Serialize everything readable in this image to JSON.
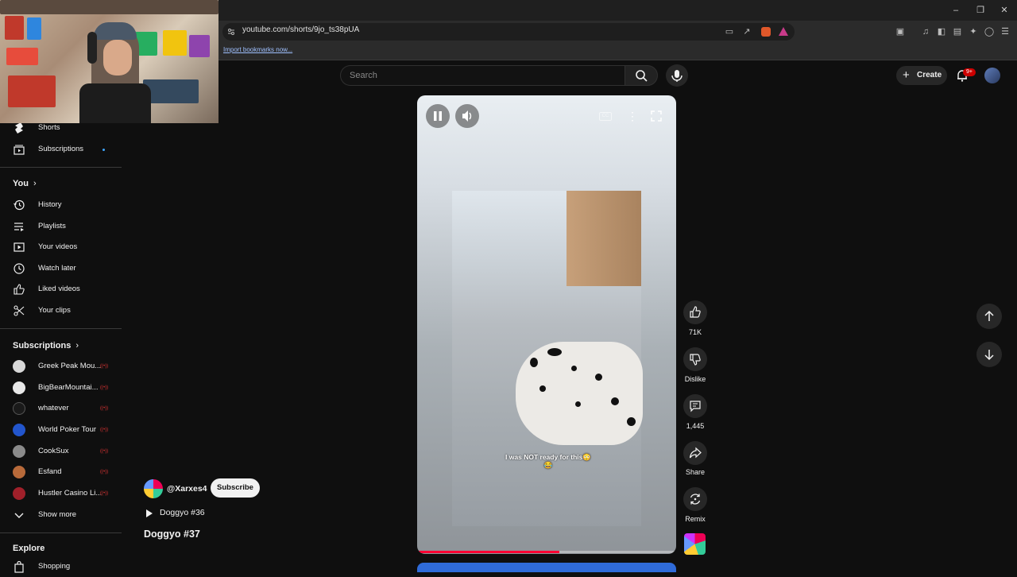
{
  "browser": {
    "url": "youtube.com/shorts/9jo_ts38pUA",
    "bookmark_text": "Import bookmarks now...",
    "window_controls": [
      "minimize-icon",
      "restore-icon",
      "close-icon"
    ]
  },
  "header": {
    "search_placeholder": "Search",
    "create_label": "Create",
    "notification_badge": "9+"
  },
  "sidebar": {
    "top_items": [
      {
        "label": "Shorts",
        "icon": "shorts-icon"
      },
      {
        "label": "Subscriptions",
        "icon": "subscriptions-icon"
      }
    ],
    "you_heading": "You",
    "you_items": [
      {
        "label": "History",
        "icon": "history-icon"
      },
      {
        "label": "Playlists",
        "icon": "playlists-icon"
      },
      {
        "label": "Your videos",
        "icon": "your-videos-icon"
      },
      {
        "label": "Watch later",
        "icon": "watch-later-icon"
      },
      {
        "label": "Liked videos",
        "icon": "liked-videos-icon"
      },
      {
        "label": "Your clips",
        "icon": "clips-icon"
      }
    ],
    "subscriptions_heading": "Subscriptions",
    "subscriptions": [
      {
        "label": "Greek Peak Mou...",
        "color": "#d8d8d8"
      },
      {
        "label": "BigBearMountai...",
        "color": "#e8e8e8"
      },
      {
        "label": "whatever",
        "color": "#1a1a1a"
      },
      {
        "label": "World Poker Tour",
        "color": "#2255cc"
      },
      {
        "label": "CookSux",
        "color": "#8a8a8a"
      },
      {
        "label": "Esfand",
        "color": "#b86a3a"
      },
      {
        "label": "Hustler Casino Li...",
        "color": "#a0202a"
      }
    ],
    "show_more": "Show more",
    "explore_heading": "Explore",
    "explore_items": [
      {
        "label": "Shopping",
        "icon": "shopping-icon"
      }
    ]
  },
  "video": {
    "caption": "I was NOT ready for this😳😂",
    "progress": 0.55
  },
  "actions": {
    "like_count": "71K",
    "dislike_label": "Dislike",
    "comment_count": "1,445",
    "share_label": "Share",
    "remix_label": "Remix"
  },
  "meta": {
    "channel": "@Xarxes4",
    "subscribe_label": "Subscribe",
    "playlist_title": "Doggyo #36",
    "video_title": "Doggyo #37"
  },
  "colors": {
    "background": "#0f0f0f",
    "accent_red": "#ff0033",
    "badge_red": "#cc0000"
  }
}
